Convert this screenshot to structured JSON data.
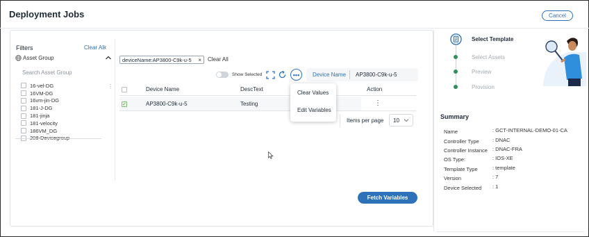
{
  "header": {
    "title": "Deployment Jobs",
    "cancel_label": "Cancel"
  },
  "filters": {
    "title": "Filters",
    "clear_all": "Clear All",
    "group_label": "Asset Group",
    "search_placeholder": "Search Asset Group",
    "items": [
      {
        "label": "16-vel-DG"
      },
      {
        "label": "16VM-DG"
      },
      {
        "label": "16vm-jin-DG"
      },
      {
        "label": "181-J-DG"
      },
      {
        "label": "181-jinja"
      },
      {
        "label": "181-velocity"
      },
      {
        "label": "186VM_DG"
      },
      {
        "label": "208-Devicegroup"
      }
    ]
  },
  "chips": {
    "active": "deviceName:AP3800-C9k-u-5",
    "remove": "×",
    "clear_all": "Clear All"
  },
  "toolbar": {
    "show_selected": "Show Selected",
    "more": "•••",
    "search_field": "Device Name",
    "search_value": "AP3800-C9k-u-5"
  },
  "table": {
    "columns": [
      "Device Name",
      "DescText",
      "Action"
    ],
    "rows": [
      {
        "device_name": "AP3800-C9k-u-5",
        "desc_text": "Testing",
        "action": "⋮",
        "checked": true
      }
    ]
  },
  "menu": {
    "items": [
      "Clear Values",
      "Edit Variables"
    ]
  },
  "pagination": {
    "items_per_page_label": "Items per page",
    "items_per_page_value": "10"
  },
  "actions": {
    "fetch_variables": "Fetch Variables"
  },
  "steps": [
    {
      "label": "Select Template",
      "state": "active"
    },
    {
      "label": "Select Assets",
      "state": "pending"
    },
    {
      "label": "Preview",
      "state": "pending"
    },
    {
      "label": "Provision",
      "state": "pending"
    }
  ],
  "summary": {
    "title": "Summary",
    "rows": [
      {
        "key": "Name",
        "value": "GCT-INTERNAL-DEMO-01-CA"
      },
      {
        "key": "Controller Type",
        "value": "DNAC"
      },
      {
        "key": "Controller Instance",
        "value": "DNAC-FRA"
      },
      {
        "key": "OS Type:",
        "value": "IOS-XE"
      },
      {
        "key": "Template Type",
        "value": "template"
      },
      {
        "key": "Version",
        "value": "7"
      },
      {
        "key": "Device Selected",
        "value": "1"
      }
    ]
  },
  "colors": {
    "accent": "#2d72b8",
    "step_dot": "#2f8f5b",
    "check_green": "#3c9a2b"
  }
}
